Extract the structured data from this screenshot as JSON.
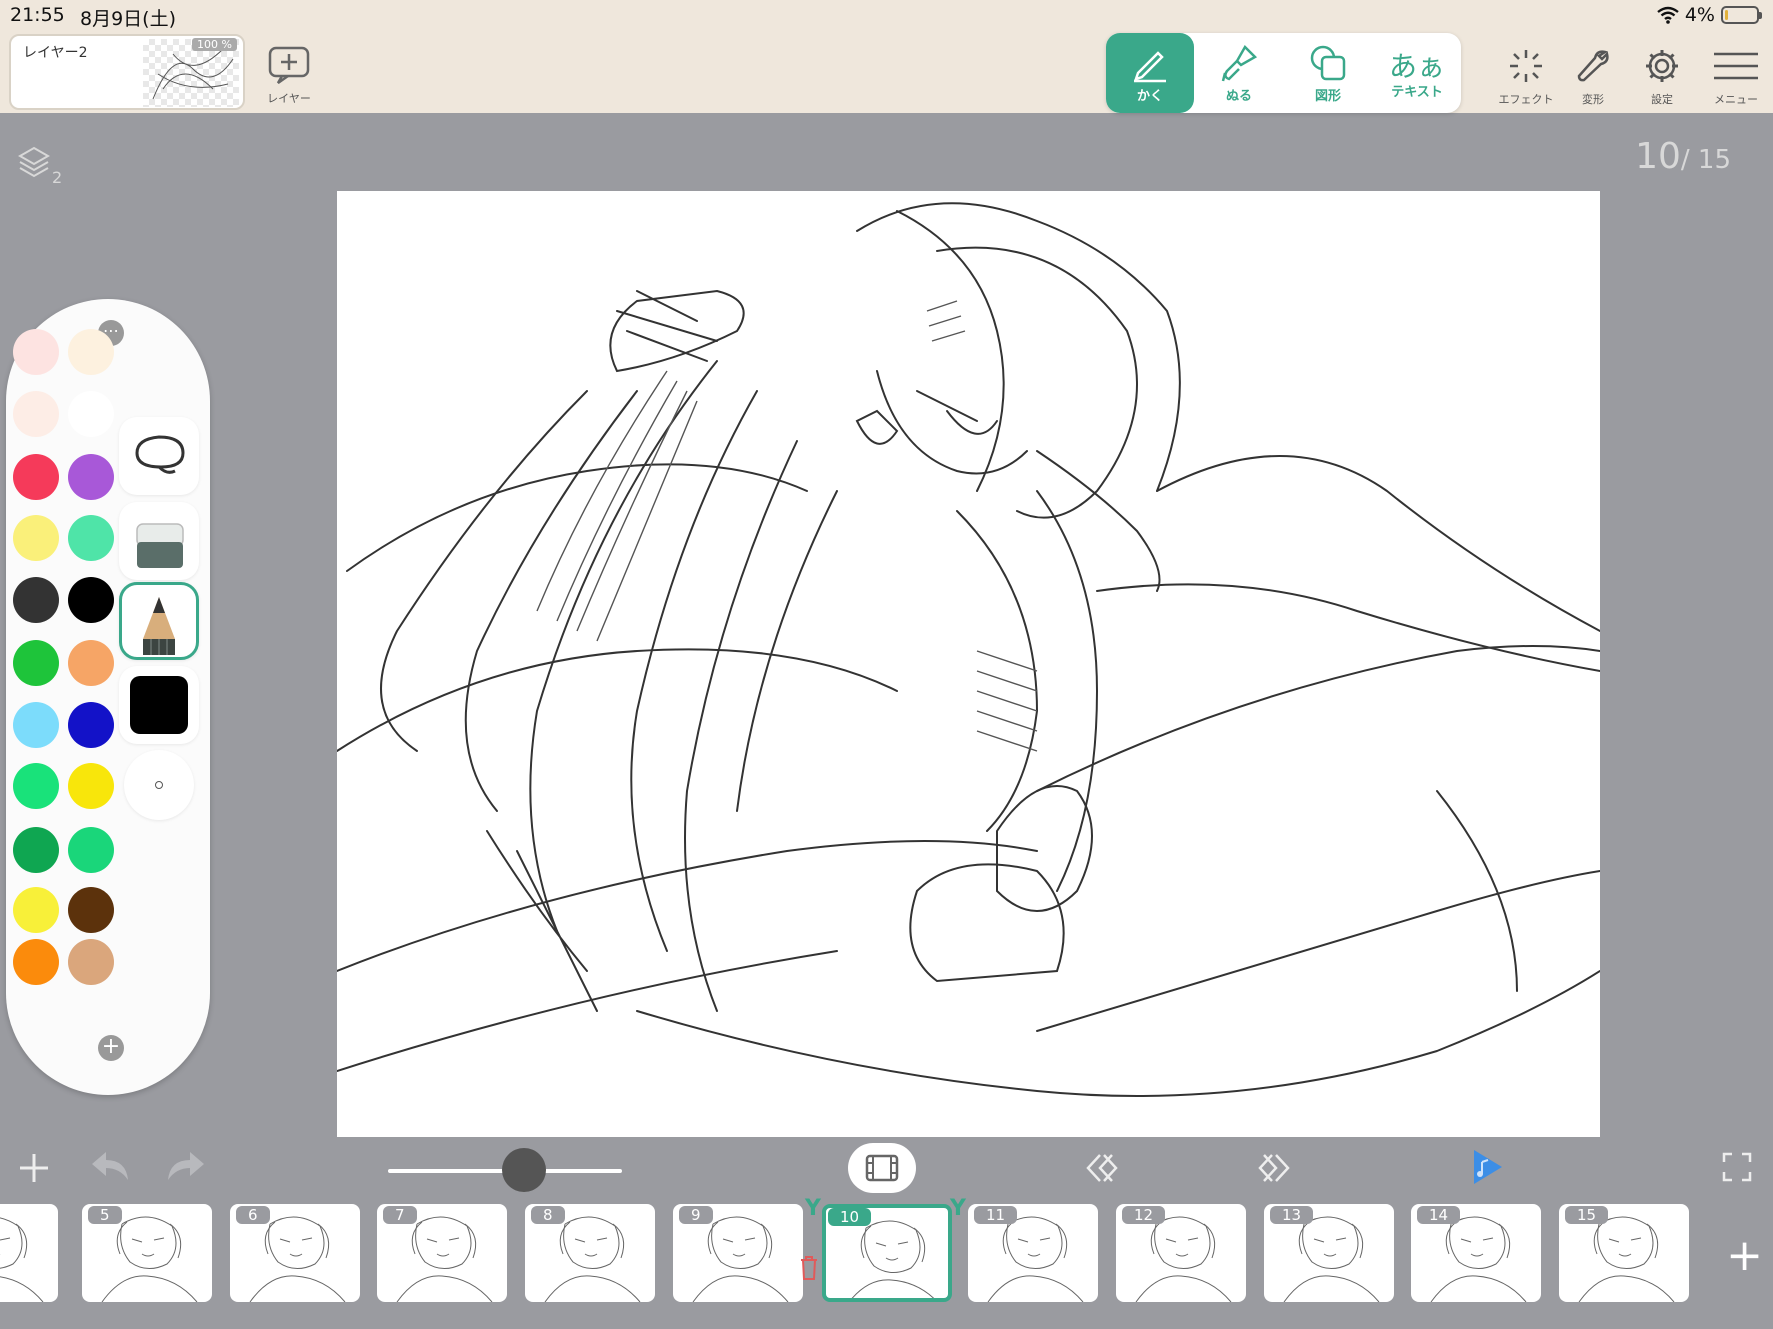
{
  "status": {
    "time": "21:55",
    "date": "8月9日(土)",
    "battery": "4%"
  },
  "layer": {
    "name": "レイヤー2",
    "opacity": "100 %",
    "add_label": "レイヤー"
  },
  "tools": [
    {
      "label": "かく",
      "icon": "pen-icon",
      "active": true
    },
    {
      "label": "ぬる",
      "icon": "brush-icon",
      "active": false
    },
    {
      "label": "図形",
      "icon": "shape-icon",
      "active": false
    },
    {
      "label": "テキスト",
      "icon": "text-icon",
      "glyph": "あぁ",
      "active": false
    }
  ],
  "right_tools": [
    {
      "label": "エフェクト",
      "icon": "effect-icon"
    },
    {
      "label": "変形",
      "icon": "wrench-icon"
    },
    {
      "label": "設定",
      "icon": "gear-icon"
    },
    {
      "label": "メニュー",
      "icon": "menu-icon"
    }
  ],
  "layers_count": "2",
  "frame_counter": {
    "current": "10",
    "total": "/ 15"
  },
  "palette": {
    "colors": [
      "#fde3e1",
      "#fdf1df",
      "#fdede6",
      "#ffffff",
      "#f53a5a",
      "#a858d8",
      "#faf07a",
      "#4fe4a8",
      "#333333",
      "#000000",
      "#1ec43a",
      "#f6a566",
      "#7cdcfb",
      "#1312c8",
      "#19e27a",
      "#f8e60b",
      "#0fa651",
      "#1ad67a",
      "#f8f039",
      "#5c320c",
      "#fb8b0c",
      "#daa67c"
    ],
    "current_color": "#000000"
  },
  "frames": [
    {
      "num": ""
    },
    {
      "num": "5"
    },
    {
      "num": "6"
    },
    {
      "num": "7"
    },
    {
      "num": "8"
    },
    {
      "num": "9"
    },
    {
      "num": "10"
    },
    {
      "num": "11"
    },
    {
      "num": "12"
    },
    {
      "num": "13"
    },
    {
      "num": "14"
    },
    {
      "num": "15"
    }
  ],
  "colors": {
    "accent": "#3aa88a",
    "play": "#3c8ee6",
    "bg": "#9a9ba0",
    "topbar": "#efe7dc"
  }
}
